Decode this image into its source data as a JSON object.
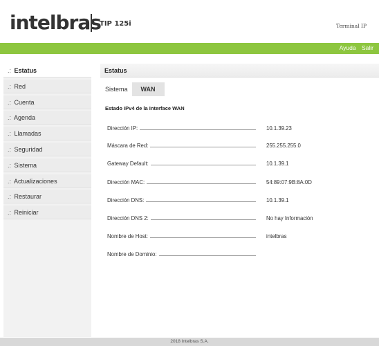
{
  "header": {
    "logo": "intelbras",
    "model": "TIP 125i",
    "terminal": "Terminal IP"
  },
  "topbar": {
    "help": "Ayuda",
    "logout": "Salir"
  },
  "sidebar": {
    "prefix": ".:",
    "items": [
      {
        "label": "Estatus"
      },
      {
        "label": "Red"
      },
      {
        "label": "Cuenta"
      },
      {
        "label": "Agenda"
      },
      {
        "label": "Llamadas"
      },
      {
        "label": "Seguridad"
      },
      {
        "label": "Sistema"
      },
      {
        "label": "Actualizaciones"
      },
      {
        "label": "Restaurar"
      },
      {
        "label": "Reiniciar"
      }
    ]
  },
  "main": {
    "title": "Estatus",
    "tabs": [
      {
        "label": "Sistema"
      },
      {
        "label": "WAN"
      }
    ],
    "section_title": "Estado IPv4 de la Interface WAN",
    "rows": [
      {
        "label": "Dirección IP:",
        "value": "10.1.39.23"
      },
      {
        "label": "Máscara de Red:",
        "value": "255.255.255.0"
      },
      {
        "label": "Gateway Default:",
        "value": "10.1.39.1"
      },
      {
        "label": "Dirección MAC:",
        "value": "54:89:07:9B:8A:0D"
      },
      {
        "label": "Dirección DNS:",
        "value": "10.1.39.1"
      },
      {
        "label": "Dirección DNS 2:",
        "value": "No hay Información"
      },
      {
        "label": "Nombre de Host:",
        "value": "intelbras"
      },
      {
        "label": "Nombre de Dominio:",
        "value": ""
      }
    ]
  },
  "footer": {
    "text": "2018 Intelbras S.A."
  },
  "colors": {
    "accent": "#8dc63f",
    "sidebar_bg": "#ececec",
    "footer_bg": "#d8d8d8"
  }
}
